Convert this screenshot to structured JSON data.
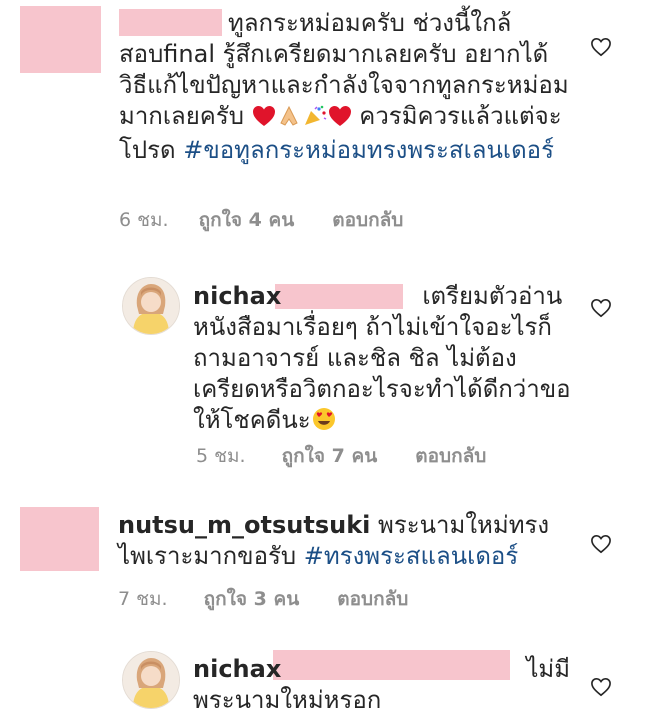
{
  "comments": [
    {
      "text_main": "ทูลกระหม่อมครับ ช่วงนี้ใกล้สอบfinal รู้สึกเครียดมากเลยครับ อยากได้วิธีแก้ไขปัญหาและกำลังใจจากทูลกระหม่อมมากเลยครับ",
      "text_after_emoji": "ควรมิควรแล้วแต่จะโปรด",
      "hashtag": "#ขอทูลกระหม่อมทรงพระสเลนเดอร์",
      "time": "6 ชม.",
      "likes": "ถูกใจ 4 คน",
      "reply": "ตอบกลับ",
      "emojis": [
        "red-heart",
        "folded-hands",
        "party-popper",
        "red-heart"
      ]
    },
    {
      "username": "nichax",
      "text": "เตรียมตัวอ่านหนังสือมาเรื่อยๆ ถ้าไม่เข้าใจอะไรก็ถามอาจารย์ และชิล ชิล ไม่ต้องเครียดหรือวิตกอะไรจะทำได้ดีกว่าขอให้โชคดีนะ",
      "emoji": "heart-eyes",
      "time": "5 ชม.",
      "likes": "ถูกใจ 7 คน",
      "reply": "ตอบกลับ"
    },
    {
      "username": "nutsu_m_otsutsuki",
      "text": "พระนามใหม่ทรงไพเราะมากขอรับ",
      "hashtag": "#ทรงพระสแลนเดอร์",
      "time": "7 ชม.",
      "likes": "ถูกใจ 3 คน",
      "reply": "ตอบกลับ"
    },
    {
      "username": "nichax",
      "text": "ไม่มีพระนามใหม่หรอก"
    }
  ],
  "colors": {
    "redaction": "#f7c5cd",
    "hashtag": "#1c4f86",
    "meta": "#8e8e8e",
    "text": "#262626"
  },
  "icons": [
    "heart-outline-icon"
  ]
}
